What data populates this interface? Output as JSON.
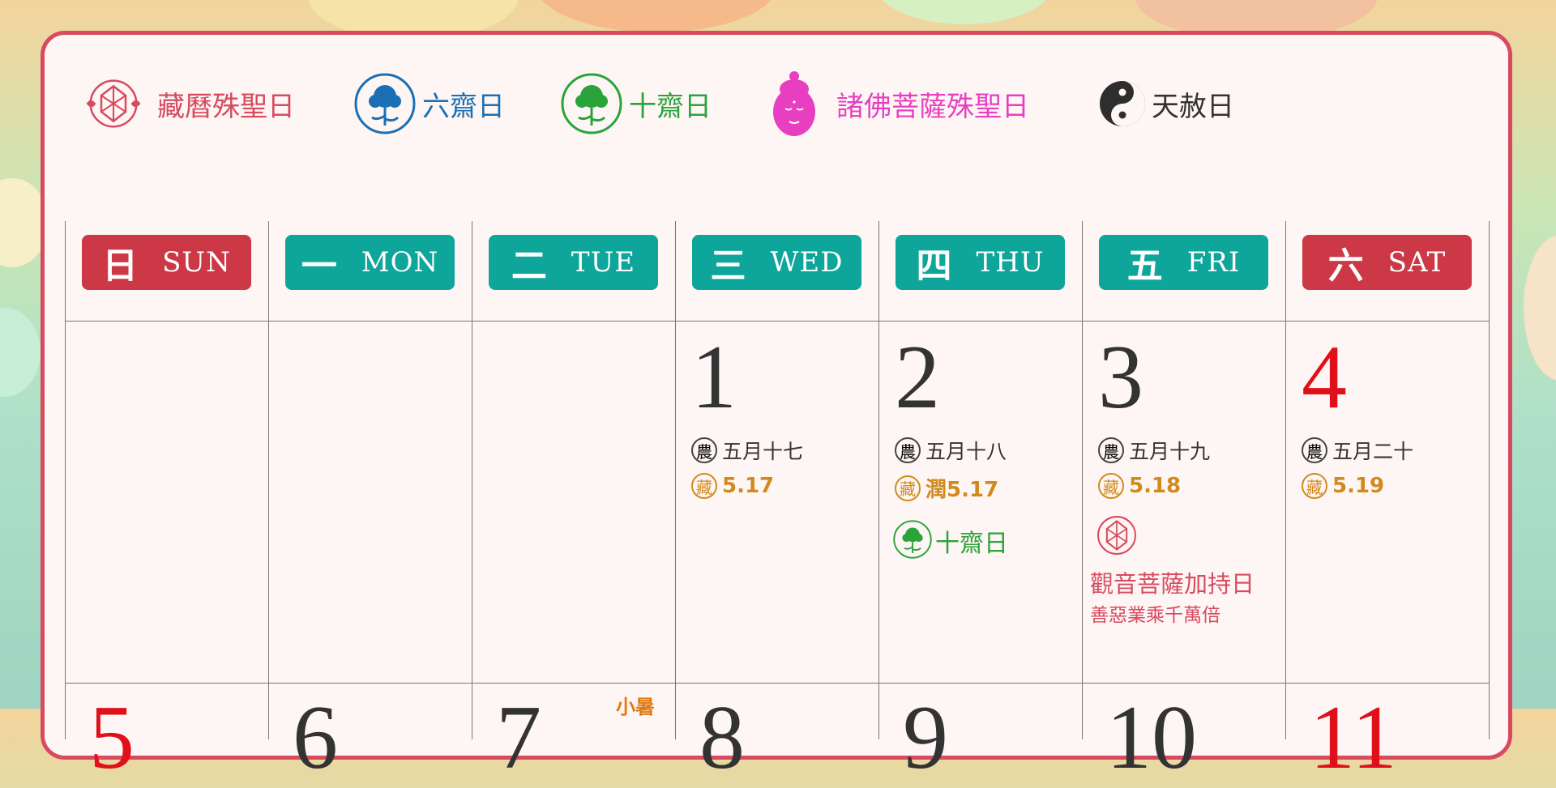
{
  "colors": {
    "accent_red": "#d84a5f",
    "weekday_teal": "#0ea59a",
    "weekend_red": "#cc3845",
    "tibetan_orange": "#d28a1e",
    "green": "#2aa33a",
    "blue": "#1a6fb5",
    "pink": "#e83fc1"
  },
  "legend": [
    {
      "icon": "endless-knot-icon",
      "label": "藏曆殊聖日",
      "color": "#d84a5f"
    },
    {
      "icon": "blue-lotus-icon",
      "label": "六齋日",
      "color": "#1a6fb5"
    },
    {
      "icon": "green-lotus-icon",
      "label": "十齋日",
      "color": "#2aa33a"
    },
    {
      "icon": "buddha-head-icon",
      "label": "諸佛菩薩殊聖日",
      "color": "#e83fc1"
    },
    {
      "icon": "yin-yang-icon",
      "label": "天赦日",
      "color": "#333333"
    }
  ],
  "weekdays": [
    {
      "zh": "日",
      "en": "SUN",
      "weekend": true
    },
    {
      "zh": "一",
      "en": "MON",
      "weekend": false
    },
    {
      "zh": "二",
      "en": "TUE",
      "weekend": false
    },
    {
      "zh": "三",
      "en": "WED",
      "weekend": false
    },
    {
      "zh": "四",
      "en": "THU",
      "weekend": false
    },
    {
      "zh": "五",
      "en": "FRI",
      "weekend": false
    },
    {
      "zh": "六",
      "en": "SAT",
      "weekend": true
    }
  ],
  "lunar_mark": "農",
  "tibetan_mark": "藏",
  "week1": [
    {
      "day": "1",
      "lunar": "五月十七",
      "tibetan": "5.17"
    },
    {
      "day": "2",
      "lunar": "五月十八",
      "tibetan": "潤5.17",
      "event": "十齋日"
    },
    {
      "day": "3",
      "lunar": "五月十九",
      "tibetan": "5.18",
      "event_title": "觀音菩薩加持日",
      "event_sub": "善惡業乘千萬倍"
    },
    {
      "day": "4",
      "lunar": "五月二十",
      "tibetan": "5.19"
    }
  ],
  "week2": [
    {
      "day": "5"
    },
    {
      "day": "6"
    },
    {
      "day": "7",
      "solar_term": "小暑"
    },
    {
      "day": "8"
    },
    {
      "day": "9"
    },
    {
      "day": "10"
    },
    {
      "day": "11"
    }
  ]
}
